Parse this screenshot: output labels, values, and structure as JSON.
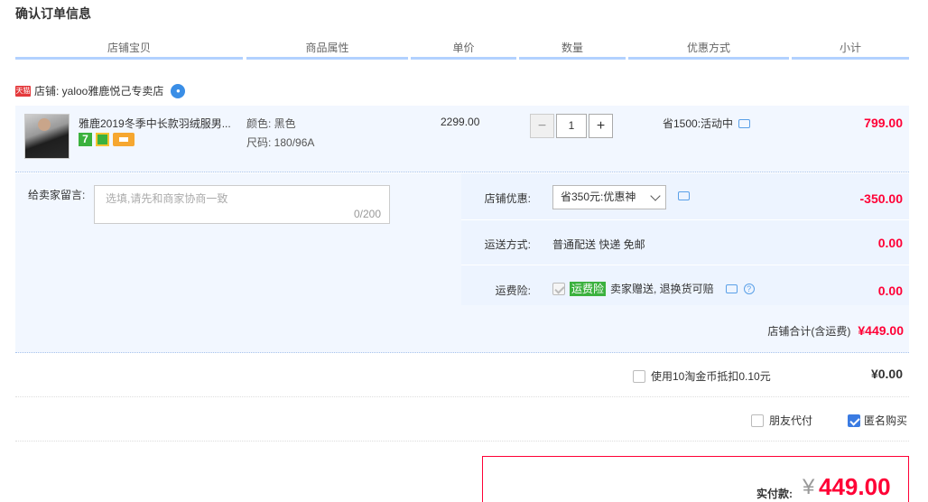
{
  "page": {
    "title": "确认订单信息"
  },
  "columns": [
    "店铺宝贝",
    "商品属性",
    "单价",
    "数量",
    "优惠方式",
    "小计"
  ],
  "shop": {
    "badge": "天猫",
    "label": "店铺: yaloo雅鹿悦己专卖店"
  },
  "item": {
    "name": "雅鹿2019冬季中长款羽绒服男...",
    "attr_color": "颜色: 黑色",
    "attr_size": "尺码: 180/96A",
    "unit_price": "2299.00",
    "quantity": "1",
    "qty_minus": "−",
    "qty_plus": "+",
    "promotion": "省1500:活动中",
    "subtotal": "799.00"
  },
  "message": {
    "label": "给卖家留言:",
    "placeholder": "选填,请先和商家协商一致",
    "count": "0/200"
  },
  "shop_discount": {
    "label": "店铺优惠:",
    "selected": "省350元:优惠神",
    "value": "-350.00"
  },
  "shipping": {
    "label": "运送方式:",
    "method": "普通配送 快递 免邮",
    "value": "0.00"
  },
  "insurance": {
    "label": "运费险:",
    "tag": "运费险",
    "text": "卖家赠送, 退换货可赔",
    "value": "0.00"
  },
  "shop_total": {
    "label": "店铺合计(含运费)",
    "value": "¥449.00"
  },
  "coins": {
    "label": "使用10淘金币抵扣0.10元",
    "value": "¥0.00"
  },
  "options": {
    "friend_pay": "朋友代付",
    "anonymous": "匿名购买"
  },
  "payment": {
    "label": "实付款:",
    "currency": "¥",
    "amount": "449.00"
  },
  "colors": {
    "accent_red": "#ff0036",
    "header_bar": "#b2d1ff",
    "panel_bg": "#f2f7ff",
    "green_tag": "#3bb13e"
  }
}
